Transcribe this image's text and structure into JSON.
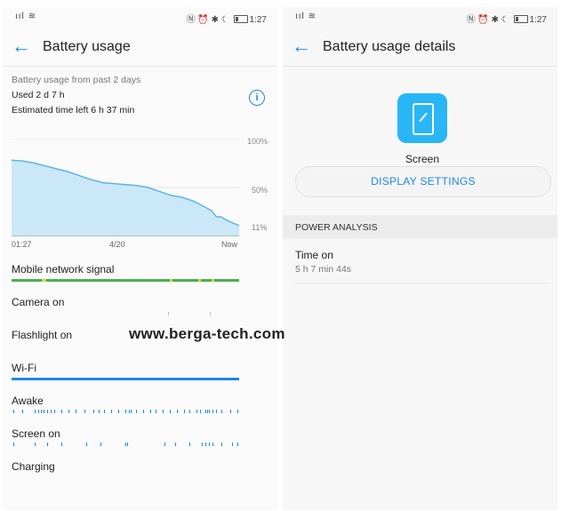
{
  "left": {
    "status": {
      "signal": "ııl",
      "wifi": "≋",
      "icons": "Ⓝ ⏰ ✱ ☾",
      "battery_pct": "11",
      "time": "1:27"
    },
    "title": "Battery usage",
    "summary": {
      "period": "Battery usage from past 2 days",
      "used": "Used 2 d 7 h",
      "estimated": "Estimated time left 6 h 37 min"
    },
    "chart_data": {
      "type": "area",
      "y_tick_labels": [
        "100%",
        "50%",
        "11%"
      ],
      "x_tick_labels": [
        "01:27",
        "4/20",
        "Now"
      ],
      "ylim": [
        0,
        100
      ],
      "x": [
        0,
        5,
        10,
        15,
        20,
        25,
        30,
        35,
        40,
        45,
        50,
        55,
        60,
        65,
        70,
        75,
        80,
        85,
        88,
        90,
        92,
        95,
        98,
        100
      ],
      "y": [
        78,
        77,
        75,
        72,
        69,
        66,
        62,
        58,
        55,
        54,
        53,
        52,
        50,
        46,
        42,
        40,
        36,
        30,
        26,
        20,
        20,
        16,
        13,
        11
      ],
      "color": "#5ab4e8",
      "fill": "#cbe8f8"
    },
    "rows": [
      {
        "label": "Mobile network signal",
        "kind": "bar",
        "color": "#4caf50"
      },
      {
        "label": "Camera on",
        "kind": "ticks",
        "color": "#1e88e5"
      },
      {
        "label": "Flashlight on",
        "kind": "none"
      },
      {
        "label": "Wi-Fi",
        "kind": "bar",
        "color": "#1e88e5"
      },
      {
        "label": "Awake",
        "kind": "ticks",
        "color": "#1e88e5"
      },
      {
        "label": "Screen on",
        "kind": "ticks",
        "color": "#1e88e5"
      },
      {
        "label": "Charging",
        "kind": "none"
      }
    ],
    "watermark": "www.berga-tech.com"
  },
  "right": {
    "status": {
      "signal": "ııl",
      "wifi": "≋",
      "icons": "Ⓝ ⏰ ✱ ☾",
      "battery_pct": "11",
      "time": "1:27"
    },
    "title": "Battery usage details",
    "app_name": "Screen",
    "app_icon": "screen-icon",
    "display_settings": "DISPLAY SETTINGS",
    "section": "POWER ANALYSIS",
    "time_on_label": "Time on",
    "time_on_value": "5 h 7 min 44s"
  },
  "colors": {
    "accent": "#1e88e5",
    "signal": "#4caf50",
    "icon_bg": "#29b6f6"
  }
}
